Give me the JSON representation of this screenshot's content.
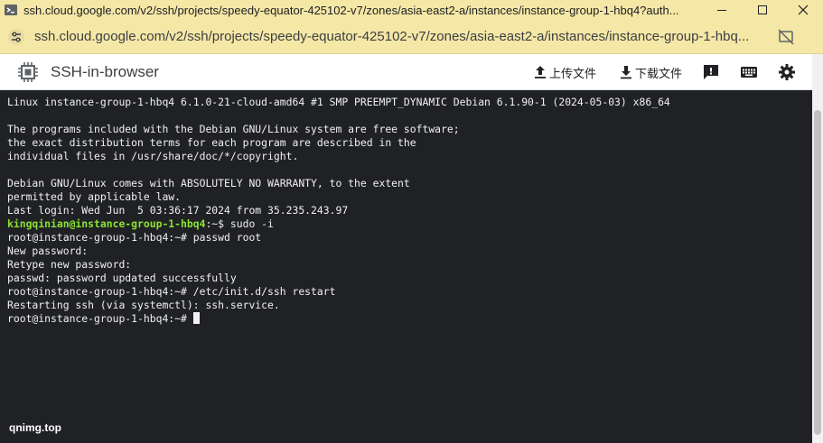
{
  "window": {
    "title": "ssh.cloud.google.com/v2/ssh/projects/speedy-equator-425102-v7/zones/asia-east2-a/instances/instance-group-1-hbq4?auth..."
  },
  "address_bar": {
    "url": "ssh.cloud.google.com/v2/ssh/projects/speedy-equator-425102-v7/zones/asia-east2-a/instances/instance-group-1-hbq..."
  },
  "toolbar": {
    "app_title": "SSH-in-browser",
    "upload_label": "上传文件",
    "download_label": "下载文件"
  },
  "terminal": {
    "lines": [
      "Linux instance-group-1-hbq4 6.1.0-21-cloud-amd64 #1 SMP PREEMPT_DYNAMIC Debian 6.1.90-1 (2024-05-03) x86_64",
      "",
      "The programs included with the Debian GNU/Linux system are free software;",
      "the exact distribution terms for each program are described in the",
      "individual files in /usr/share/doc/*/copyright.",
      "",
      "Debian GNU/Linux comes with ABSOLUTELY NO WARRANTY, to the extent",
      "permitted by applicable law.",
      "Last login: Wed Jun  5 03:36:17 2024 from 35.235.243.97"
    ],
    "prompt_user": "kingqinian@instance-group-1-hbq4",
    "prompt_suffix": ":~$ sudo -i",
    "lines_after": [
      "root@instance-group-1-hbq4:~# passwd root",
      "New password:",
      "Retype new password:",
      "passwd: password updated successfully",
      "root@instance-group-1-hbq4:~# /etc/init.d/ssh restart",
      "Restarting ssh (via systemctl): ssh.service."
    ],
    "current_prompt": "root@instance-group-1-hbq4:~# "
  },
  "watermark": "qnimg.top",
  "colors": {
    "titlebar": "#f5e7a6",
    "terminal_bg": "#202124",
    "user_prompt": "#8ae234"
  }
}
